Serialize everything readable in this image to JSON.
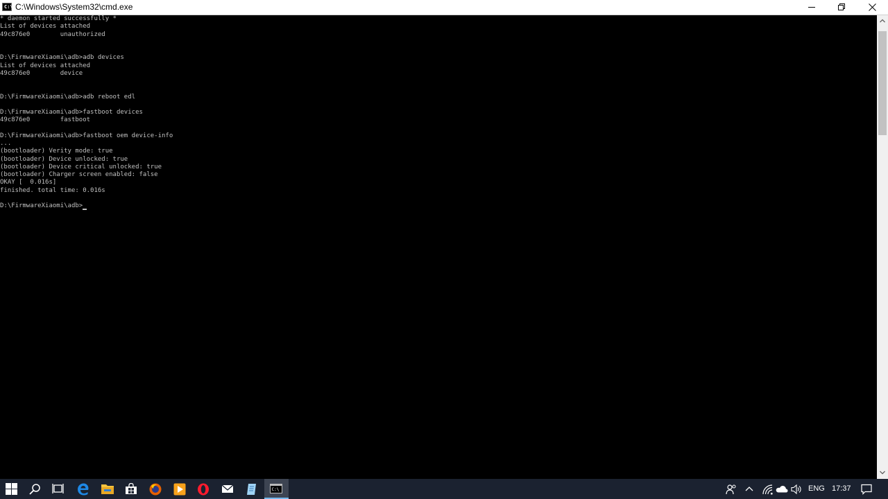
{
  "window": {
    "title": "C:\\Windows\\System32\\cmd.exe",
    "icon": "cmd-icon",
    "controls": [
      "minimize-icon",
      "restore-icon",
      "close-icon"
    ]
  },
  "console": {
    "text_color": "#c0c0c0",
    "background": "#000000",
    "lines": [
      "* daemon started successfully *",
      "List of devices attached",
      "49c876e0        unauthorized",
      "",
      "",
      "D:\\FirmwareXiaomi\\adb>adb devices",
      "List of devices attached",
      "49c876e0        device",
      "",
      "",
      "D:\\FirmwareXiaomi\\adb>adb reboot edl",
      "",
      "D:\\FirmwareXiaomi\\adb>fastboot devices",
      "49c876e0        fastboot",
      "",
      "D:\\FirmwareXiaomi\\adb>fastboot oem device-info",
      "...",
      "(bootloader) Verity mode: true",
      "(bootloader) Device unlocked: true",
      "(bootloader) Device critical unlocked: true",
      "(bootloader) Charger screen enabled: false",
      "OKAY [  0.016s]",
      "finished. total time: 0.016s",
      "",
      "D:\\FirmwareXiaomi\\adb>"
    ]
  },
  "taskbar": {
    "apps": [
      "start-icon",
      "search-icon",
      "task-view-icon",
      "edge-icon",
      "file-explorer-icon",
      "store-icon",
      "firefox-icon",
      "media-player-icon",
      "opera-icon",
      "mail-icon",
      "notepad-icon",
      "cmd-icon"
    ],
    "active_app": "cmd-icon",
    "tray": {
      "icons": [
        "people-icon",
        "chevron-up-icon",
        "wifi-icon",
        "onedrive-icon",
        "volume-icon"
      ],
      "language": "ENG",
      "time": "17:37",
      "notification_icon": "action-center-icon"
    },
    "colors": {
      "background": "#1b2230",
      "active": "#3d4452",
      "accent": "#76b9ed"
    }
  }
}
